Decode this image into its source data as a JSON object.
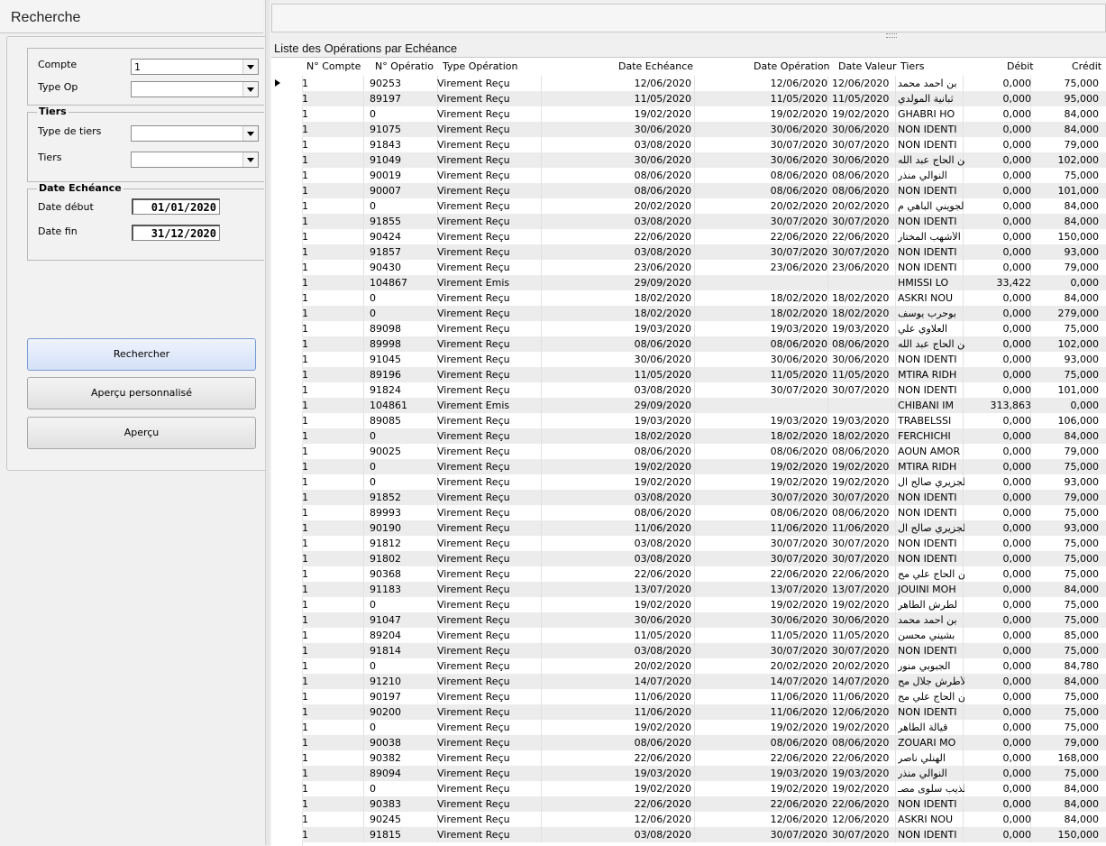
{
  "left": {
    "title": "Recherche",
    "compte_label": "Compte",
    "compte_value": "1",
    "typeop_label": "Type Op",
    "typeop_value": "",
    "tiers_group": "Tiers",
    "typetiers_label": "Type de tiers",
    "typetiers_value": "",
    "tiers_label": "Tiers",
    "tiers_value": "",
    "date_group": "Date Echéance",
    "date_debut_label": "Date début",
    "date_debut_value": "01/01/2020",
    "date_fin_label": "Date fin",
    "date_fin_value": "31/12/2020",
    "btn_rechercher": "Rechercher",
    "btn_apercu_perso": "Aperçu personnalisé",
    "btn_apercu": "Aperçu"
  },
  "right": {
    "list_title": "Liste des Opérations par Echéance"
  },
  "grid": {
    "headers": [
      "N° Compte",
      "N° Opératio",
      "Type Opération",
      "Date Echéance",
      "Date Opération",
      "Date Valeur",
      "Tiers",
      "Débit",
      "Crédit"
    ],
    "rows": [
      [
        "1",
        "90253",
        "Virement Reçu",
        "12/06/2020",
        "12/06/2020",
        "12/06/2020",
        "بن أحمد محمد",
        "0,000",
        "75,000"
      ],
      [
        "1",
        "89197",
        "Virement Reçu",
        "11/05/2020",
        "11/05/2020",
        "11/05/2020",
        "ثبانية المولدي",
        "0,000",
        "95,000"
      ],
      [
        "1",
        "0",
        "Virement Reçu",
        "19/02/2020",
        "19/02/2020",
        "19/02/2020",
        "GHABRI HO",
        "0,000",
        "84,000"
      ],
      [
        "1",
        "91075",
        "Virement Reçu",
        "30/06/2020",
        "30/06/2020",
        "30/06/2020",
        "NON IDENTI",
        "0,000",
        "84,000"
      ],
      [
        "1",
        "91843",
        "Virement Reçu",
        "03/08/2020",
        "30/07/2020",
        "30/07/2020",
        "NON IDENTI",
        "0,000",
        "79,000"
      ],
      [
        "1",
        "91049",
        "Virement Reçu",
        "30/06/2020",
        "30/06/2020",
        "30/06/2020",
        "بن الحاج عبد الله",
        "0,000",
        "102,000"
      ],
      [
        "1",
        "90019",
        "Virement Reçu",
        "08/06/2020",
        "08/06/2020",
        "08/06/2020",
        "النوالي منذر",
        "0,000",
        "75,000"
      ],
      [
        "1",
        "90007",
        "Virement Reçu",
        "08/06/2020",
        "08/06/2020",
        "08/06/2020",
        "NON IDENTI",
        "0,000",
        "101,000"
      ],
      [
        "1",
        "0",
        "Virement Reçu",
        "20/02/2020",
        "20/02/2020",
        "20/02/2020",
        "الجويني الباهي م",
        "0,000",
        "84,000"
      ],
      [
        "1",
        "91855",
        "Virement Reçu",
        "03/08/2020",
        "30/07/2020",
        "30/07/2020",
        "NON IDENTI",
        "0,000",
        "84,000"
      ],
      [
        "1",
        "90424",
        "Virement Reçu",
        "22/06/2020",
        "22/06/2020",
        "22/06/2020",
        "الأشهب المختار",
        "0,000",
        "150,000"
      ],
      [
        "1",
        "91857",
        "Virement Reçu",
        "03/08/2020",
        "30/07/2020",
        "30/07/2020",
        "NON IDENTI",
        "0,000",
        "93,000"
      ],
      [
        "1",
        "90430",
        "Virement Reçu",
        "23/06/2020",
        "23/06/2020",
        "23/06/2020",
        "NON IDENTI",
        "0,000",
        "79,000"
      ],
      [
        "1",
        "104867",
        "Virement Emis",
        "29/09/2020",
        "",
        "",
        "HMISSI  LO",
        "33,422",
        "0,000"
      ],
      [
        "1",
        "0",
        "Virement Reçu",
        "18/02/2020",
        "18/02/2020",
        "18/02/2020",
        "ASKRI NOU",
        "0,000",
        "84,000"
      ],
      [
        "1",
        "0",
        "Virement Reçu",
        "18/02/2020",
        "18/02/2020",
        "18/02/2020",
        "بوحرب يوسف",
        "0,000",
        "279,000"
      ],
      [
        "1",
        "89098",
        "Virement Reçu",
        "19/03/2020",
        "19/03/2020",
        "19/03/2020",
        "العلاوي علي",
        "0,000",
        "75,000"
      ],
      [
        "1",
        "89998",
        "Virement Reçu",
        "08/06/2020",
        "08/06/2020",
        "08/06/2020",
        "بن الحاج عبد الله",
        "0,000",
        "102,000"
      ],
      [
        "1",
        "91045",
        "Virement Reçu",
        "30/06/2020",
        "30/06/2020",
        "30/06/2020",
        "NON IDENTI",
        "0,000",
        "93,000"
      ],
      [
        "1",
        "89196",
        "Virement Reçu",
        "11/05/2020",
        "11/05/2020",
        "11/05/2020",
        "MTIRA RIDH",
        "0,000",
        "75,000"
      ],
      [
        "1",
        "91824",
        "Virement Reçu",
        "03/08/2020",
        "30/07/2020",
        "30/07/2020",
        "NON IDENTI",
        "0,000",
        "101,000"
      ],
      [
        "1",
        "104861",
        "Virement Emis",
        "29/09/2020",
        "",
        "",
        "CHIBANI IM",
        "313,863",
        "0,000"
      ],
      [
        "1",
        "89085",
        "Virement Reçu",
        "19/03/2020",
        "19/03/2020",
        "19/03/2020",
        "TRABELSSI",
        "0,000",
        "106,000"
      ],
      [
        "1",
        "0",
        "Virement Reçu",
        "18/02/2020",
        "18/02/2020",
        "18/02/2020",
        "FERCHICHI",
        "0,000",
        "84,000"
      ],
      [
        "1",
        "90025",
        "Virement Reçu",
        "08/06/2020",
        "08/06/2020",
        "08/06/2020",
        "AOUN AMOR",
        "0,000",
        "79,000"
      ],
      [
        "1",
        "0",
        "Virement Reçu",
        "19/02/2020",
        "19/02/2020",
        "19/02/2020",
        "MTIRA RIDH",
        "0,000",
        "75,000"
      ],
      [
        "1",
        "0",
        "Virement Reçu",
        "19/02/2020",
        "19/02/2020",
        "19/02/2020",
        "الجزيري صالح ال",
        "0,000",
        "93,000"
      ],
      [
        "1",
        "91852",
        "Virement Reçu",
        "03/08/2020",
        "30/07/2020",
        "30/07/2020",
        "NON IDENTI",
        "0,000",
        "79,000"
      ],
      [
        "1",
        "89993",
        "Virement Reçu",
        "08/06/2020",
        "08/06/2020",
        "08/06/2020",
        "NON IDENTI",
        "0,000",
        "75,000"
      ],
      [
        "1",
        "90190",
        "Virement Reçu",
        "11/06/2020",
        "11/06/2020",
        "11/06/2020",
        "الجزيري صالح ال",
        "0,000",
        "93,000"
      ],
      [
        "1",
        "91812",
        "Virement Reçu",
        "03/08/2020",
        "30/07/2020",
        "30/07/2020",
        "NON IDENTI",
        "0,000",
        "75,000"
      ],
      [
        "1",
        "91802",
        "Virement Reçu",
        "03/08/2020",
        "30/07/2020",
        "30/07/2020",
        "NON IDENTI",
        "0,000",
        "75,000"
      ],
      [
        "1",
        "90368",
        "Virement Reçu",
        "22/06/2020",
        "22/06/2020",
        "22/06/2020",
        "بن الحاج علي مح",
        "0,000",
        "75,000"
      ],
      [
        "1",
        "91183",
        "Virement Reçu",
        "13/07/2020",
        "13/07/2020",
        "13/07/2020",
        "JOUINI MOH",
        "0,000",
        "84,000"
      ],
      [
        "1",
        "0",
        "Virement Reçu",
        "19/02/2020",
        "19/02/2020",
        "19/02/2020",
        "لطرش الطاهر",
        "0,000",
        "75,000"
      ],
      [
        "1",
        "91047",
        "Virement Reçu",
        "30/06/2020",
        "30/06/2020",
        "30/06/2020",
        "بن أحمد محمد",
        "0,000",
        "75,000"
      ],
      [
        "1",
        "89204",
        "Virement Reçu",
        "11/05/2020",
        "11/05/2020",
        "11/05/2020",
        "بشيني محسن",
        "0,000",
        "85,000"
      ],
      [
        "1",
        "91814",
        "Virement Reçu",
        "03/08/2020",
        "30/07/2020",
        "30/07/2020",
        "NON IDENTI",
        "0,000",
        "75,000"
      ],
      [
        "1",
        "0",
        "Virement Reçu",
        "20/02/2020",
        "20/02/2020",
        "20/02/2020",
        "الجبوبي منور",
        "0,000",
        "84,780"
      ],
      [
        "1",
        "91210",
        "Virement Reçu",
        "14/07/2020",
        "14/07/2020",
        "14/07/2020",
        "الأطرش جلال مح",
        "0,000",
        "84,000"
      ],
      [
        "1",
        "90197",
        "Virement Reçu",
        "11/06/2020",
        "11/06/2020",
        "11/06/2020",
        "بن الحاج علي مح",
        "0,000",
        "75,000"
      ],
      [
        "1",
        "90200",
        "Virement Reçu",
        "11/06/2020",
        "11/06/2020",
        "12/06/2020",
        "NON IDENTI",
        "0,000",
        "75,000"
      ],
      [
        "1",
        "0",
        "Virement Reçu",
        "19/02/2020",
        "19/02/2020",
        "19/02/2020",
        "قيالة الطاهر",
        "0,000",
        "75,000"
      ],
      [
        "1",
        "90038",
        "Virement Reçu",
        "08/06/2020",
        "08/06/2020",
        "08/06/2020",
        "ZOUARI MO",
        "0,000",
        "79,000"
      ],
      [
        "1",
        "90382",
        "Virement Reçu",
        "22/06/2020",
        "22/06/2020",
        "22/06/2020",
        "الهنلي ناصر",
        "0,000",
        "168,000"
      ],
      [
        "1",
        "89094",
        "Virement Reçu",
        "19/03/2020",
        "19/03/2020",
        "19/03/2020",
        "النوالي منذر",
        "0,000",
        "75,000"
      ],
      [
        "1",
        "0",
        "Virement Reçu",
        "19/02/2020",
        "19/02/2020",
        "19/02/2020",
        "الذيب سلوى مصـ",
        "0,000",
        "84,000"
      ],
      [
        "1",
        "90383",
        "Virement Reçu",
        "22/06/2020",
        "22/06/2020",
        "22/06/2020",
        "NON IDENTI",
        "0,000",
        "84,000"
      ],
      [
        "1",
        "90245",
        "Virement Reçu",
        "12/06/2020",
        "12/06/2020",
        "12/06/2020",
        "ASKRI NOU",
        "0,000",
        "84,000"
      ],
      [
        "1",
        "91815",
        "Virement Reçu",
        "03/08/2020",
        "30/07/2020",
        "30/07/2020",
        "NON IDENTI",
        "0,000",
        "150,000"
      ]
    ]
  }
}
